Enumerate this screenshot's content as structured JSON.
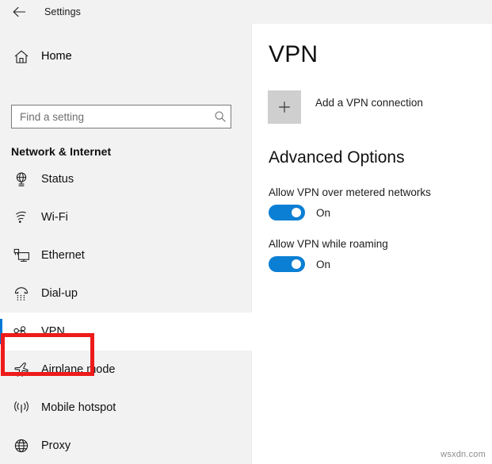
{
  "window": {
    "title": "Settings",
    "back_icon": "back-arrow-icon"
  },
  "sidebar": {
    "home": {
      "label": "Home",
      "icon": "home-icon"
    },
    "search": {
      "value": "",
      "placeholder": "Find a setting",
      "icon": "search-icon"
    },
    "group_title": "Network & Internet",
    "items": [
      {
        "label": "Status",
        "icon": "globe-status-icon",
        "selected": false
      },
      {
        "label": "Wi-Fi",
        "icon": "wifi-icon",
        "selected": false
      },
      {
        "label": "Ethernet",
        "icon": "ethernet-monitor-icon",
        "selected": false
      },
      {
        "label": "Dial-up",
        "icon": "dialup-phone-icon",
        "selected": false
      },
      {
        "label": "VPN",
        "icon": "vpn-key-icon",
        "selected": true
      },
      {
        "label": "Airplane mode",
        "icon": "airplane-icon",
        "selected": false
      },
      {
        "label": "Mobile hotspot",
        "icon": "hotspot-icon",
        "selected": false
      },
      {
        "label": "Proxy",
        "icon": "globe-proxy-icon",
        "selected": false
      }
    ]
  },
  "main": {
    "title": "VPN",
    "add_connection": {
      "label": "Add a VPN connection",
      "icon": "plus-icon"
    },
    "section_title": "Advanced Options",
    "settings": [
      {
        "name": "Allow VPN over metered networks",
        "state": "On",
        "on": true
      },
      {
        "name": "Allow VPN while roaming",
        "state": "On",
        "on": true
      }
    ]
  },
  "watermark": "wsxdn.com",
  "colors": {
    "accent": "#0b7fd4",
    "selection_bar": "#0078d7",
    "highlight_box": "#ee1b1b",
    "sidebar_bg": "#f2f2f2",
    "content_bg": "#ffffff",
    "plus_square": "#cfcfcf"
  }
}
